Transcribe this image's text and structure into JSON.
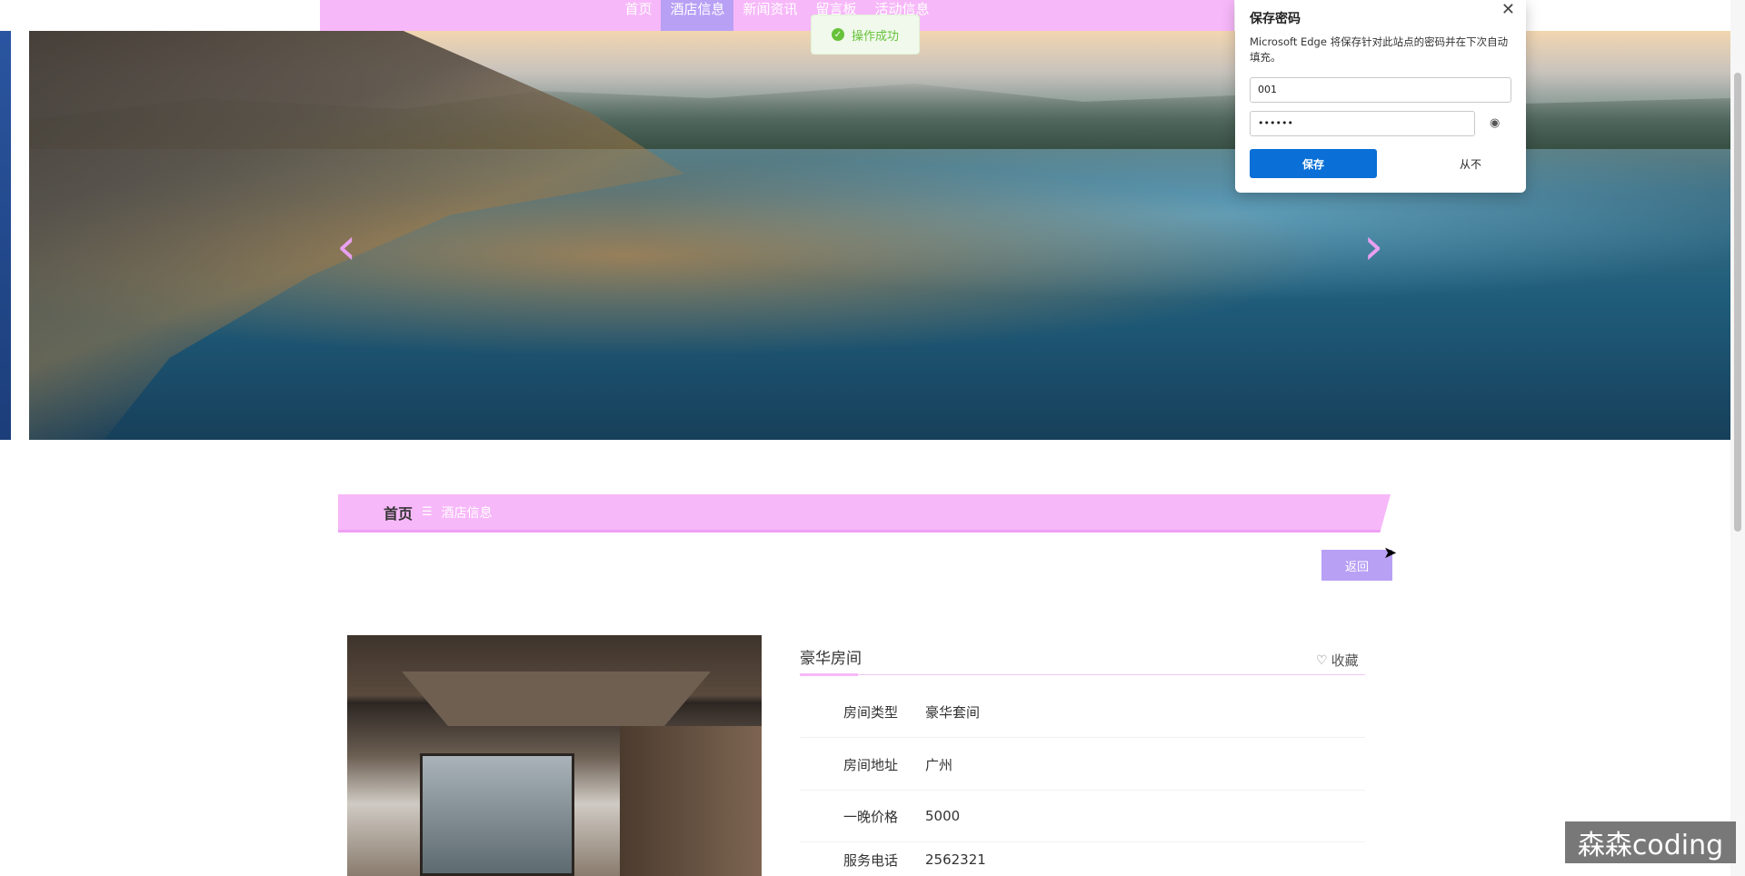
{
  "nav": {
    "items": [
      {
        "label": "首页",
        "active": false
      },
      {
        "label": "酒店信息",
        "active": true
      },
      {
        "label": "新闻资讯",
        "active": false
      },
      {
        "label": "留言板",
        "active": false
      },
      {
        "label": "活动信息",
        "active": false
      }
    ]
  },
  "toast": {
    "message": "操作成功"
  },
  "password_popup": {
    "title": "保存密码",
    "description": "Microsoft Edge 将保存针对此站点的密码并在下次自动填充。",
    "username": "001",
    "password": "••••••",
    "save_label": "保存",
    "never_label": "从不"
  },
  "banner": {
    "prev_icon": "chevron-left-icon",
    "next_icon": "chevron-right-icon"
  },
  "breadcrumb": {
    "home": "首页",
    "separator": "☰",
    "current": "酒店信息"
  },
  "back_label": "返回",
  "detail": {
    "title": "豪华房间",
    "favorite_label": "收藏",
    "rows": [
      {
        "key": "房间类型",
        "value": "豪华套间"
      },
      {
        "key": "房间地址",
        "value": "广州"
      },
      {
        "key": "一晚价格",
        "value": "5000"
      },
      {
        "key": "服务电话",
        "value": "2562321"
      }
    ]
  },
  "watermark": "森森coding",
  "colors": {
    "accent_pink": "#f7b8f9",
    "accent_purple": "#b8a0f5",
    "edge_blue": "#0a6fd6",
    "success_green": "#67c23a"
  }
}
